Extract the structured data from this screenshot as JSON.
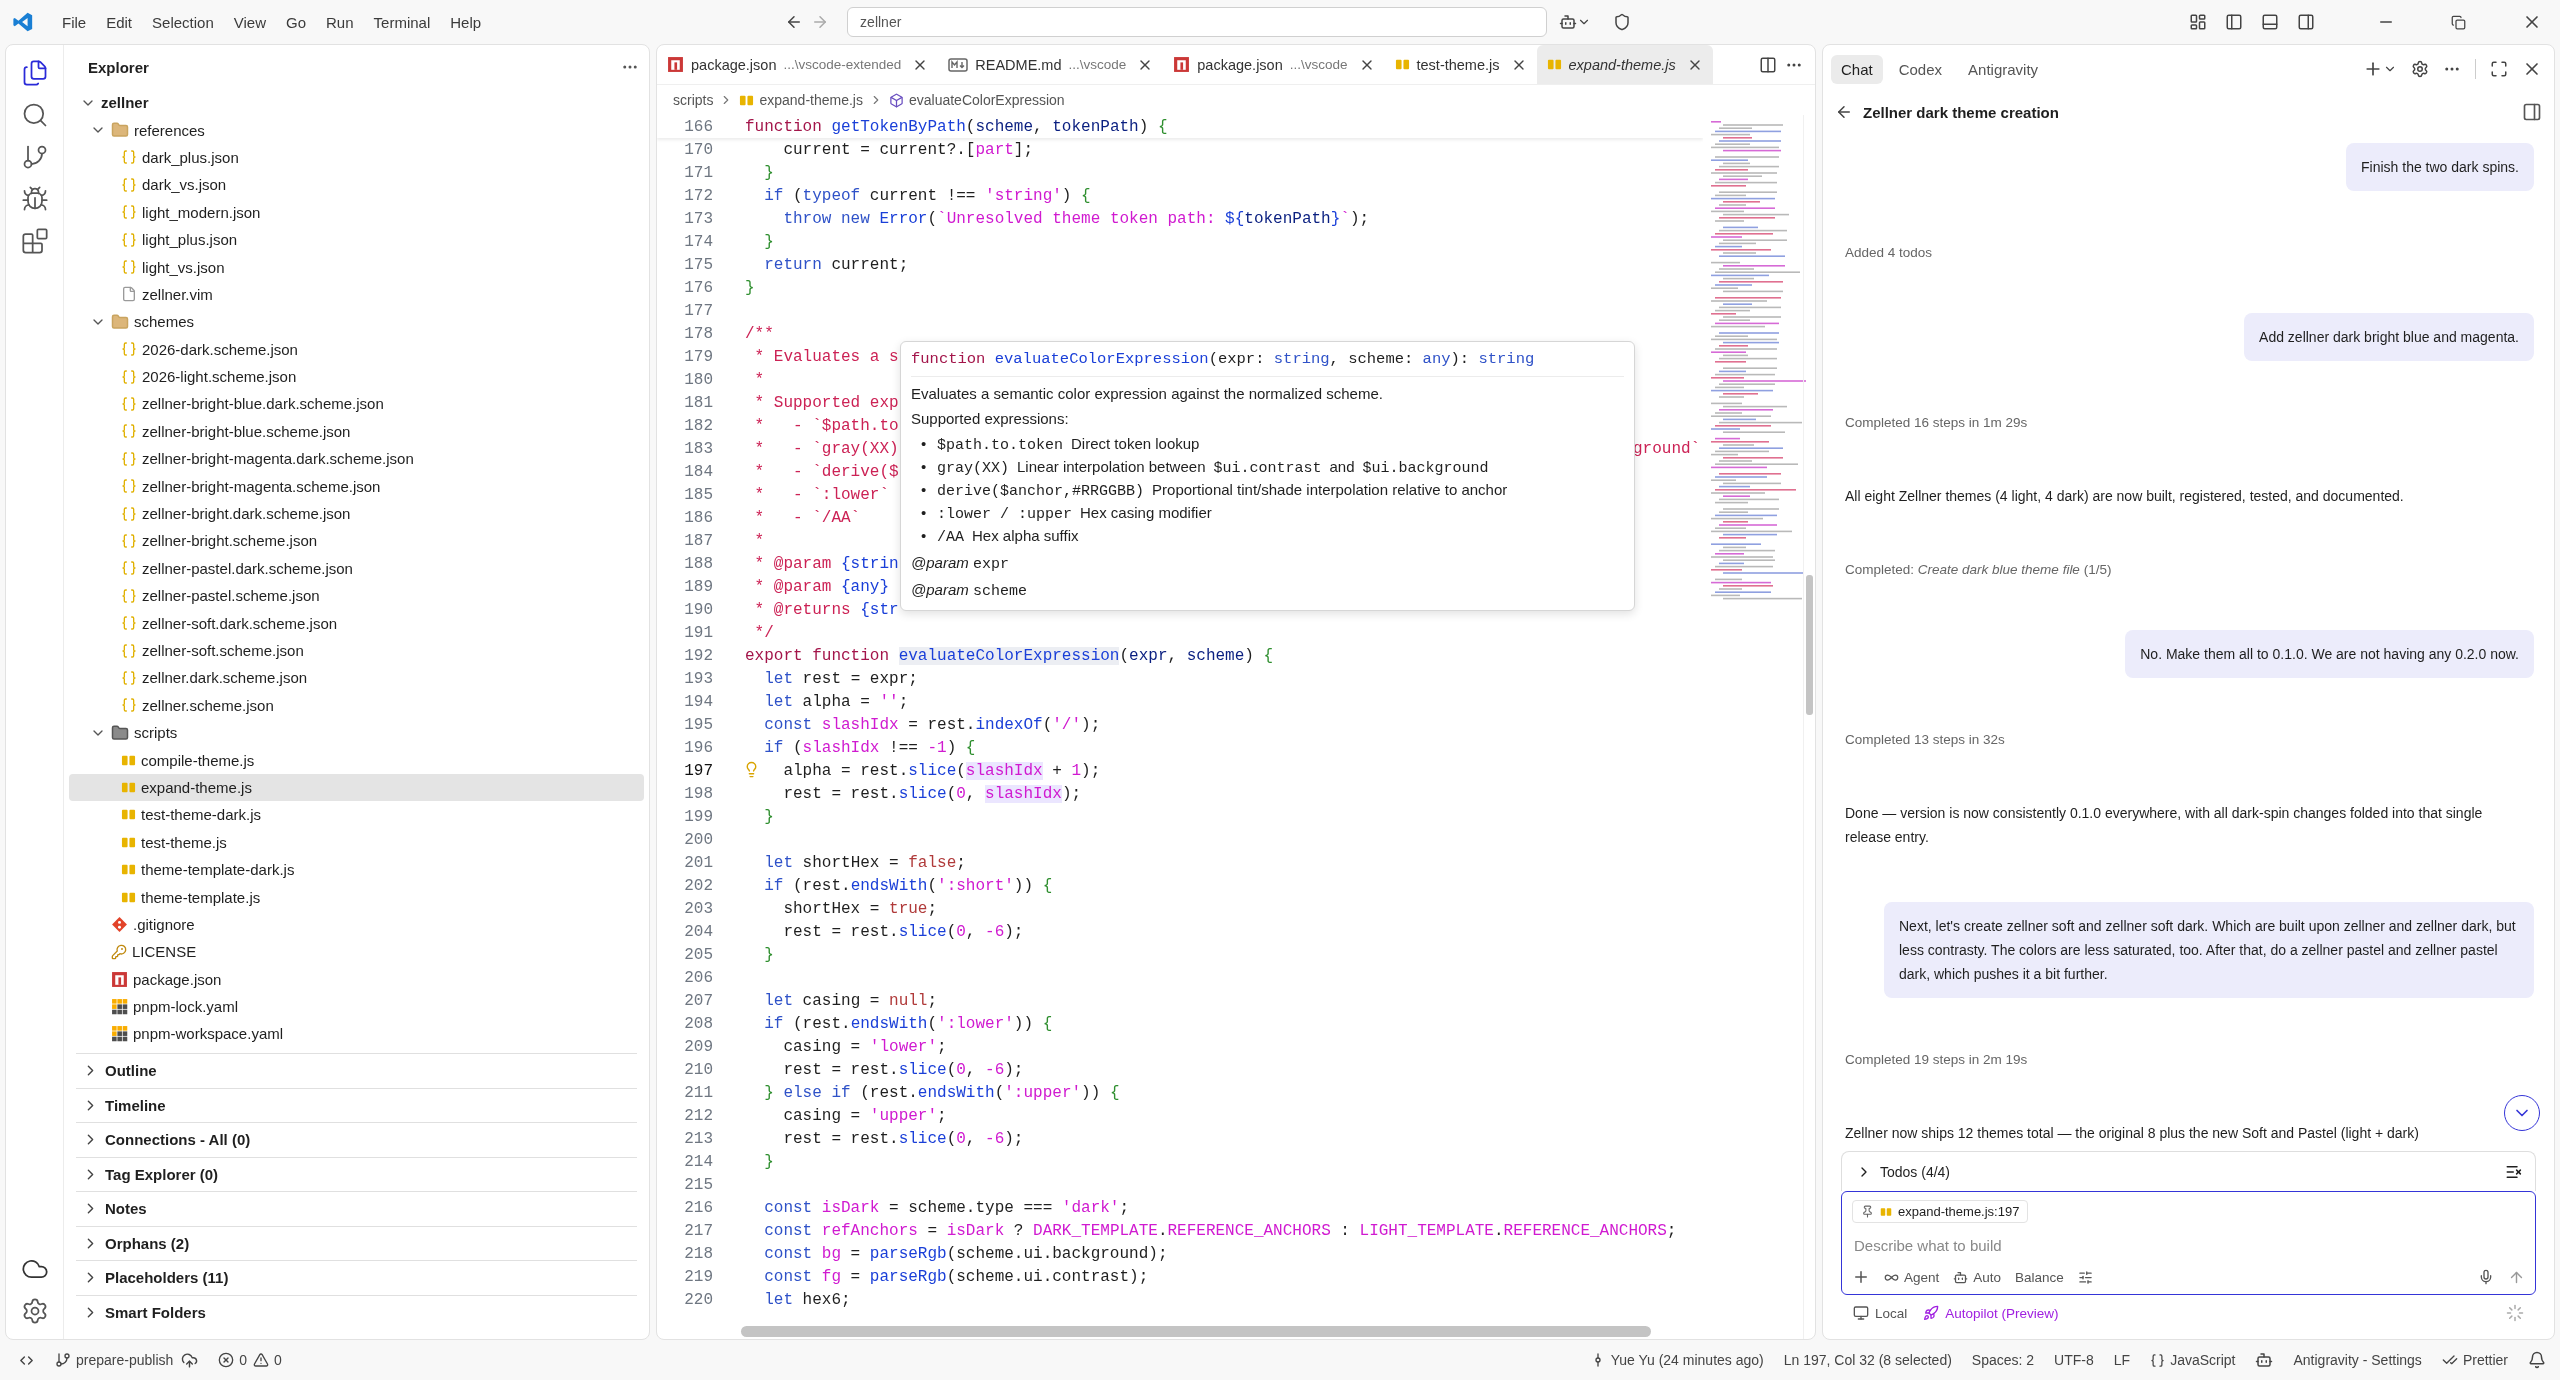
{
  "title_bar": {
    "menu": [
      "File",
      "Edit",
      "Selection",
      "View",
      "Go",
      "Run",
      "Terminal",
      "Help"
    ],
    "search": "zellner"
  },
  "activity_bar": [
    {
      "kind": "files",
      "selected": true
    },
    {
      "kind": "search",
      "selected": false
    },
    {
      "kind": "source-control",
      "selected": false
    },
    {
      "kind": "run",
      "selected": false
    },
    {
      "kind": "extensions",
      "selected": false
    }
  ],
  "explorer": {
    "title": "Explorer",
    "tree": {
      "label": "zellner",
      "kind": "root",
      "expanded": true,
      "selected": false,
      "children": [
        {
          "label": "references",
          "kind": "folder",
          "expanded": true,
          "selected": false,
          "children": [
            {
              "label": "dark_plus.json",
              "kind": "json",
              "selected": false
            },
            {
              "label": "dark_vs.json",
              "kind": "json",
              "selected": false
            },
            {
              "label": "light_modern.json",
              "kind": "json",
              "selected": false
            },
            {
              "label": "light_plus.json",
              "kind": "json",
              "selected": false
            },
            {
              "label": "light_vs.json",
              "kind": "json",
              "selected": false
            },
            {
              "label": "zellner.vim",
              "kind": "file",
              "selected": false
            }
          ]
        },
        {
          "label": "schemes",
          "kind": "folder",
          "expanded": true,
          "selected": false,
          "children": [
            {
              "label": "2026-dark.scheme.json",
              "kind": "json",
              "selected": false
            },
            {
              "label": "2026-light.scheme.json",
              "kind": "json",
              "selected": false
            },
            {
              "label": "zellner-bright-blue.dark.scheme.json",
              "kind": "json",
              "selected": false
            },
            {
              "label": "zellner-bright-blue.scheme.json",
              "kind": "json",
              "selected": false
            },
            {
              "label": "zellner-bright-magenta.dark.scheme.json",
              "kind": "json",
              "selected": false
            },
            {
              "label": "zellner-bright-magenta.scheme.json",
              "kind": "json",
              "selected": false
            },
            {
              "label": "zellner-bright.dark.scheme.json",
              "kind": "json",
              "selected": false
            },
            {
              "label": "zellner-bright.scheme.json",
              "kind": "json",
              "selected": false
            },
            {
              "label": "zellner-pastel.dark.scheme.json",
              "kind": "json",
              "selected": false
            },
            {
              "label": "zellner-pastel.scheme.json",
              "kind": "json",
              "selected": false
            },
            {
              "label": "zellner-soft.dark.scheme.json",
              "kind": "json",
              "selected": false
            },
            {
              "label": "zellner-soft.scheme.json",
              "kind": "json",
              "selected": false
            },
            {
              "label": "zellner.dark.scheme.json",
              "kind": "json",
              "selected": false
            },
            {
              "label": "zellner.scheme.json",
              "kind": "json",
              "selected": false
            }
          ]
        },
        {
          "label": "scripts",
          "kind": "scripts",
          "expanded": true,
          "selected": false,
          "children": [
            {
              "label": "compile-theme.js",
              "kind": "js",
              "selected": false
            },
            {
              "label": "expand-theme.js",
              "kind": "js",
              "selected": true
            },
            {
              "label": "test-theme-dark.js",
              "kind": "js",
              "selected": false
            },
            {
              "label": "test-theme.js",
              "kind": "js",
              "selected": false
            },
            {
              "label": "theme-template-dark.js",
              "kind": "js",
              "selected": false
            },
            {
              "label": "theme-template.js",
              "kind": "js",
              "selected": false
            }
          ]
        },
        {
          "label": ".gitignore",
          "kind": "git",
          "selected": false
        },
        {
          "label": "LICENSE",
          "kind": "license",
          "selected": false
        },
        {
          "label": "package.json",
          "kind": "npm",
          "selected": false
        },
        {
          "label": "pnpm-lock.yaml",
          "kind": "pnpm",
          "selected": false
        },
        {
          "label": "pnpm-workspace.yaml",
          "kind": "pnpm",
          "selected": false
        }
      ]
    },
    "sections": [
      {
        "label": "Outline",
        "expanded": false
      },
      {
        "label": "Timeline",
        "expanded": false
      },
      {
        "label": "Connections - All (0)",
        "expanded": false
      },
      {
        "label": "Tag Explorer (0)",
        "expanded": false
      },
      {
        "label": "Notes",
        "expanded": false
      },
      {
        "label": "Orphans (2)",
        "expanded": false
      },
      {
        "label": "Placeholders (11)",
        "expanded": false
      },
      {
        "label": "Smart Folders",
        "expanded": false
      }
    ]
  },
  "editor": {
    "tabs": [
      {
        "label": "package.json",
        "path": "...\\vscode-extended",
        "kind": "npm",
        "selected": false,
        "preview": false
      },
      {
        "label": "README.md",
        "path": "...\\vscode",
        "kind": "md",
        "selected": false,
        "preview": false
      },
      {
        "label": "package.json",
        "path": "...\\vscode",
        "kind": "npm",
        "selected": false,
        "preview": false
      },
      {
        "label": "test-theme.js",
        "kind": "js",
        "selected": false,
        "preview": false
      },
      {
        "label": "expand-theme.js",
        "kind": "js",
        "selected": true,
        "preview": true
      }
    ],
    "breadcrumbs": [
      {
        "label": "scripts",
        "kind": "dir"
      },
      {
        "label": "expand-theme.js",
        "kind": "js"
      },
      {
        "label": "evaluateColorExpression",
        "kind": "symbol"
      }
    ],
    "sticky": {
      "n": "166",
      "t": [
        {
          "text": "function ",
          "kind": "decl"
        },
        {
          "text": "getTokenByPath",
          "kind": "fn"
        },
        {
          "text": "(",
          "kind": "plain"
        },
        {
          "text": "scheme",
          "kind": "param"
        },
        {
          "text": ", ",
          "kind": "plain"
        },
        {
          "text": "tokenPath",
          "kind": "param"
        },
        {
          "text": ") ",
          "kind": "plain"
        },
        {
          "text": "{",
          "kind": "brace"
        }
      ]
    },
    "lines": [
      {
        "n": "170",
        "t": [
          {
            "text": "    current = current?.[",
            "kind": "plain"
          },
          {
            "text": "part",
            "kind": "str"
          },
          {
            "text": "];",
            "kind": "plain"
          }
        ]
      },
      {
        "n": "171",
        "t": [
          {
            "text": "  }",
            "kind": "brace"
          }
        ]
      },
      {
        "n": "172",
        "t": [
          {
            "text": "  if",
            "kind": "kw"
          },
          {
            "text": " (",
            "kind": "plain"
          },
          {
            "text": "typeof",
            "kind": "kw"
          },
          {
            "text": " current !== ",
            "kind": "plain"
          },
          {
            "text": "'string'",
            "kind": "str"
          },
          {
            "text": ") ",
            "kind": "plain"
          },
          {
            "text": "{",
            "kind": "brace"
          }
        ]
      },
      {
        "n": "173",
        "t": [
          {
            "text": "    throw new ",
            "kind": "kw"
          },
          {
            "text": "Error",
            "kind": "fn"
          },
          {
            "text": "(",
            "kind": "plain"
          },
          {
            "text": "`Unresolved theme token path: ",
            "kind": "str"
          },
          {
            "text": "${",
            "kind": "fn"
          },
          {
            "text": "tokenPath",
            "kind": "param"
          },
          {
            "text": "}",
            "kind": "fn"
          },
          {
            "text": "`",
            "kind": "str"
          },
          {
            "text": ");",
            "kind": "plain"
          }
        ]
      },
      {
        "n": "174",
        "t": [
          {
            "text": "  }",
            "kind": "brace"
          }
        ]
      },
      {
        "n": "175",
        "t": [
          {
            "text": "  return",
            "kind": "kw"
          },
          {
            "text": " current;",
            "kind": "plain"
          }
        ]
      },
      {
        "n": "176",
        "t": [
          {
            "text": "}",
            "kind": "brace"
          }
        ]
      },
      {
        "n": "177"
      },
      {
        "n": "178",
        "t": [
          {
            "text": "/**",
            "kind": "comment"
          }
        ]
      },
      {
        "n": "179",
        "t": [
          {
            "text": " * Evaluates a s",
            "kind": "comment"
          }
        ]
      },
      {
        "n": "180",
        "t": [
          {
            "text": " *",
            "kind": "comment"
          }
        ]
      },
      {
        "n": "181",
        "t": [
          {
            "text": " * Supported exp",
            "kind": "comment"
          }
        ]
      },
      {
        "n": "182",
        "t": [
          {
            "text": " *   - `$path.to",
            "kind": "comment"
          }
        ]
      },
      {
        "n": "183",
        "t": [
          {
            "text": " *   - `gray(XX)",
            "kind": "comment"
          }
        ],
        "tail": "ground`"
      },
      {
        "n": "184",
        "t": [
          {
            "text": " *   - `derive($",
            "kind": "comment"
          }
        ]
      },
      {
        "n": "185",
        "t": [
          {
            "text": " *   - `:lower`",
            "kind": "comment"
          }
        ]
      },
      {
        "n": "186",
        "t": [
          {
            "text": " *   - `/AA`",
            "kind": "comment"
          }
        ]
      },
      {
        "n": "187",
        "t": [
          {
            "text": " *",
            "kind": "comment"
          }
        ]
      },
      {
        "n": "188",
        "t": [
          {
            "text": " * @param ",
            "kind": "comment"
          },
          {
            "text": "{strin",
            "kind": "fn"
          }
        ]
      },
      {
        "n": "189",
        "t": [
          {
            "text": " * @param ",
            "kind": "comment"
          },
          {
            "text": "{any}",
            "kind": "fn"
          }
        ]
      },
      {
        "n": "190",
        "t": [
          {
            "text": " * @returns ",
            "kind": "comment"
          },
          {
            "text": "{str",
            "kind": "fn"
          }
        ]
      },
      {
        "n": "191",
        "t": [
          {
            "text": " */",
            "kind": "comment"
          }
        ]
      },
      {
        "n": "192",
        "t": [
          {
            "text": "export function ",
            "kind": "decl"
          },
          {
            "text": "evaluateColorExpression",
            "kind": "fnhl"
          },
          {
            "text": "(",
            "kind": "plain"
          },
          {
            "text": "expr",
            "kind": "param"
          },
          {
            "text": ", ",
            "kind": "plain"
          },
          {
            "text": "scheme",
            "kind": "param"
          },
          {
            "text": ") ",
            "kind": "plain"
          },
          {
            "text": "{",
            "kind": "brace"
          }
        ]
      },
      {
        "n": "193",
        "t": [
          {
            "text": "  let",
            "kind": "kw"
          },
          {
            "text": " rest = expr;",
            "kind": "plain"
          }
        ]
      },
      {
        "n": "194",
        "t": [
          {
            "text": "  let",
            "kind": "kw"
          },
          {
            "text": " alpha = ",
            "kind": "plain"
          },
          {
            "text": "''",
            "kind": "str"
          },
          {
            "text": ";",
            "kind": "plain"
          }
        ]
      },
      {
        "n": "195",
        "t": [
          {
            "text": "  const ",
            "kind": "kw"
          },
          {
            "text": "slashIdx",
            "kind": "var"
          },
          {
            "text": " = rest.",
            "kind": "plain"
          },
          {
            "text": "indexOf",
            "kind": "fn"
          },
          {
            "text": "(",
            "kind": "plain"
          },
          {
            "text": "'/'",
            "kind": "str"
          },
          {
            "text": ");",
            "kind": "plain"
          }
        ]
      },
      {
        "n": "196",
        "t": [
          {
            "text": "  if",
            "kind": "kw"
          },
          {
            "text": " (",
            "kind": "plain"
          },
          {
            "text": "slashIdx",
            "kind": "var"
          },
          {
            "text": " !== ",
            "kind": "plain"
          },
          {
            "text": "-1",
            "kind": "num"
          },
          {
            "text": ") ",
            "kind": "plain"
          },
          {
            "text": "{",
            "kind": "brace"
          }
        ]
      },
      {
        "n": "197",
        "current": true,
        "lightbulb": true,
        "t": [
          {
            "text": "    alpha = rest.",
            "kind": "plain"
          },
          {
            "text": "slice",
            "kind": "fn"
          },
          {
            "text": "(",
            "kind": "plain"
          },
          {
            "text": "slashIdx",
            "kind": "varhl"
          },
          {
            "text": " + ",
            "kind": "plain"
          },
          {
            "text": "1",
            "kind": "num"
          },
          {
            "text": ");",
            "kind": "plain"
          }
        ]
      },
      {
        "n": "198",
        "t": [
          {
            "text": "    rest = rest.",
            "kind": "plain"
          },
          {
            "text": "slice",
            "kind": "fn"
          },
          {
            "text": "(",
            "kind": "plain"
          },
          {
            "text": "0",
            "kind": "num"
          },
          {
            "text": ", ",
            "kind": "plain"
          },
          {
            "text": "slashIdx",
            "kind": "varhl"
          },
          {
            "text": ");",
            "kind": "plain"
          }
        ]
      },
      {
        "n": "199",
        "t": [
          {
            "text": "  }",
            "kind": "brace"
          }
        ]
      },
      {
        "n": "200"
      },
      {
        "n": "201",
        "t": [
          {
            "text": "  let",
            "kind": "kw"
          },
          {
            "text": " shortHex = ",
            "kind": "plain"
          },
          {
            "text": "false",
            "kind": "lit"
          },
          {
            "text": ";",
            "kind": "plain"
          }
        ]
      },
      {
        "n": "202",
        "t": [
          {
            "text": "  if",
            "kind": "kw"
          },
          {
            "text": " (rest.",
            "kind": "plain"
          },
          {
            "text": "endsWith",
            "kind": "fn"
          },
          {
            "text": "(",
            "kind": "plain"
          },
          {
            "text": "':short'",
            "kind": "str"
          },
          {
            "text": ")) ",
            "kind": "plain"
          },
          {
            "text": "{",
            "kind": "brace"
          }
        ]
      },
      {
        "n": "203",
        "t": [
          {
            "text": "    shortHex = ",
            "kind": "plain"
          },
          {
            "text": "true",
            "kind": "lit"
          },
          {
            "text": ";",
            "kind": "plain"
          }
        ]
      },
      {
        "n": "204",
        "t": [
          {
            "text": "    rest = rest.",
            "kind": "plain"
          },
          {
            "text": "slice",
            "kind": "fn"
          },
          {
            "text": "(",
            "kind": "plain"
          },
          {
            "text": "0",
            "kind": "num"
          },
          {
            "text": ", ",
            "kind": "plain"
          },
          {
            "text": "-6",
            "kind": "num"
          },
          {
            "text": ");",
            "kind": "plain"
          }
        ]
      },
      {
        "n": "205",
        "t": [
          {
            "text": "  }",
            "kind": "brace"
          }
        ]
      },
      {
        "n": "206"
      },
      {
        "n": "207",
        "t": [
          {
            "text": "  let",
            "kind": "kw"
          },
          {
            "text": " casing = ",
            "kind": "plain"
          },
          {
            "text": "null",
            "kind": "lit"
          },
          {
            "text": ";",
            "kind": "plain"
          }
        ]
      },
      {
        "n": "208",
        "t": [
          {
            "text": "  if",
            "kind": "kw"
          },
          {
            "text": " (rest.",
            "kind": "plain"
          },
          {
            "text": "endsWith",
            "kind": "fn"
          },
          {
            "text": "(",
            "kind": "plain"
          },
          {
            "text": "':lower'",
            "kind": "str"
          },
          {
            "text": ")) ",
            "kind": "plain"
          },
          {
            "text": "{",
            "kind": "brace"
          }
        ]
      },
      {
        "n": "209",
        "t": [
          {
            "text": "    casing = ",
            "kind": "plain"
          },
          {
            "text": "'lower'",
            "kind": "str"
          },
          {
            "text": ";",
            "kind": "plain"
          }
        ]
      },
      {
        "n": "210",
        "t": [
          {
            "text": "    rest = rest.",
            "kind": "plain"
          },
          {
            "text": "slice",
            "kind": "fn"
          },
          {
            "text": "(",
            "kind": "plain"
          },
          {
            "text": "0",
            "kind": "num"
          },
          {
            "text": ", ",
            "kind": "plain"
          },
          {
            "text": "-6",
            "kind": "num"
          },
          {
            "text": ");",
            "kind": "plain"
          }
        ]
      },
      {
        "n": "211",
        "t": [
          {
            "text": "  }",
            "kind": "brace"
          },
          {
            "text": " else if",
            "kind": "kw"
          },
          {
            "text": " (rest.",
            "kind": "plain"
          },
          {
            "text": "endsWith",
            "kind": "fn"
          },
          {
            "text": "(",
            "kind": "plain"
          },
          {
            "text": "':upper'",
            "kind": "str"
          },
          {
            "text": ")) ",
            "kind": "plain"
          },
          {
            "text": "{",
            "kind": "brace"
          }
        ]
      },
      {
        "n": "212",
        "t": [
          {
            "text": "    casing = ",
            "kind": "plain"
          },
          {
            "text": "'upper'",
            "kind": "str"
          },
          {
            "text": ";",
            "kind": "plain"
          }
        ]
      },
      {
        "n": "213",
        "t": [
          {
            "text": "    rest = rest.",
            "kind": "plain"
          },
          {
            "text": "slice",
            "kind": "fn"
          },
          {
            "text": "(",
            "kind": "plain"
          },
          {
            "text": "0",
            "kind": "num"
          },
          {
            "text": ", ",
            "kind": "plain"
          },
          {
            "text": "-6",
            "kind": "num"
          },
          {
            "text": ");",
            "kind": "plain"
          }
        ]
      },
      {
        "n": "214",
        "t": [
          {
            "text": "  }",
            "kind": "brace"
          }
        ]
      },
      {
        "n": "215"
      },
      {
        "n": "216",
        "t": [
          {
            "text": "  const ",
            "kind": "kw"
          },
          {
            "text": "isDark",
            "kind": "var"
          },
          {
            "text": " = scheme.type === ",
            "kind": "plain"
          },
          {
            "text": "'dark'",
            "kind": "str"
          },
          {
            "text": ";",
            "kind": "plain"
          }
        ]
      },
      {
        "n": "217",
        "t": [
          {
            "text": "  const ",
            "kind": "kw"
          },
          {
            "text": "refAnchors",
            "kind": "var"
          },
          {
            "text": " = ",
            "kind": "plain"
          },
          {
            "text": "isDark",
            "kind": "var"
          },
          {
            "text": " ? ",
            "kind": "plain"
          },
          {
            "text": "DARK_TEMPLATE",
            "kind": "var"
          },
          {
            "text": ".",
            "kind": "plain"
          },
          {
            "text": "REFERENCE_ANCHORS",
            "kind": "var"
          },
          {
            "text": " : ",
            "kind": "plain"
          },
          {
            "text": "LIGHT_TEMPLATE",
            "kind": "var"
          },
          {
            "text": ".",
            "kind": "plain"
          },
          {
            "text": "REFERENCE_ANCHORS",
            "kind": "var"
          },
          {
            "text": ";",
            "kind": "plain"
          }
        ]
      },
      {
        "n": "218",
        "t": [
          {
            "text": "  const ",
            "kind": "kw"
          },
          {
            "text": "bg",
            "kind": "var"
          },
          {
            "text": " = ",
            "kind": "plain"
          },
          {
            "text": "parseRgb",
            "kind": "fn"
          },
          {
            "text": "(scheme.ui.background);",
            "kind": "plain"
          }
        ]
      },
      {
        "n": "219",
        "t": [
          {
            "text": "  const ",
            "kind": "kw"
          },
          {
            "text": "fg",
            "kind": "var"
          },
          {
            "text": " = ",
            "kind": "plain"
          },
          {
            "text": "parseRgb",
            "kind": "fn"
          },
          {
            "text": "(scheme.ui.contrast);",
            "kind": "plain"
          }
        ]
      },
      {
        "n": "220",
        "t": [
          {
            "text": "  let",
            "kind": "kw"
          },
          {
            "text": " hex6;",
            "kind": "plain"
          }
        ]
      }
    ],
    "hover": {
      "signature": [
        {
          "text": "function ",
          "kind": "decl"
        },
        {
          "text": "evaluateColorExpression",
          "kind": "fn"
        },
        {
          "text": "(expr: ",
          "kind": "plain"
        },
        {
          "text": "string",
          "kind": "kw"
        },
        {
          "text": ", scheme: ",
          "kind": "plain"
        },
        {
          "text": "any",
          "kind": "kw"
        },
        {
          "text": "): ",
          "kind": "plain"
        },
        {
          "text": "string",
          "kind": "kw"
        }
      ],
      "description": "Evaluates a semantic color expression against the normalized scheme.",
      "list_title": "Supported expressions:",
      "items": [
        {
          "bullet": "•",
          "parts": [
            {
              "text": "$path.to.token",
              "kind": "code"
            },
            {
              "text": "Direct token lookup",
              "kind": "prose"
            }
          ]
        },
        {
          "bullet": "•",
          "parts": [
            {
              "text": "gray(XX)",
              "kind": "code"
            },
            {
              "text": "Linear interpolation between",
              "kind": "prose"
            },
            {
              "text": "$ui.contrast",
              "kind": "code"
            },
            {
              "text": "and",
              "kind": "prose"
            },
            {
              "text": "$ui.background",
              "kind": "code"
            }
          ]
        },
        {
          "bullet": "•",
          "parts": [
            {
              "text": "derive($anchor,#RRGGBB)",
              "kind": "code"
            },
            {
              "text": "Proportional tint/shade interpolation relative to anchor",
              "kind": "prose"
            }
          ]
        },
        {
          "bullet": "•",
          "parts": [
            {
              "text": ":lower / :upper",
              "kind": "code"
            },
            {
              "text": "Hex casing modifier",
              "kind": "prose"
            }
          ]
        },
        {
          "bullet": "•",
          "parts": [
            {
              "text": "/AA",
              "kind": "code"
            },
            {
              "text": "Hex alpha suffix",
              "kind": "prose"
            }
          ]
        }
      ],
      "params": [
        {
          "tag": "@param",
          "name": "expr"
        },
        {
          "tag": "@param",
          "name": "scheme"
        }
      ]
    }
  },
  "chat": {
    "tabs": [
      {
        "label": "Chat",
        "selected": true
      },
      {
        "label": "Codex",
        "selected": false
      },
      {
        "label": "Antigravity",
        "selected": false
      }
    ],
    "title": "Zellner dark theme creation",
    "messages": [
      {
        "kind": "user",
        "text": "Finish the two dark spins."
      },
      {
        "kind": "status",
        "text": "Added 4 todos"
      },
      {
        "kind": "user",
        "text": "Add zellner dark bright blue and magenta."
      },
      {
        "kind": "status",
        "text": "Completed 16 steps in 1m 29s"
      },
      {
        "kind": "reply",
        "text": "All eight Zellner themes (4 light, 4 dark) are now built, registered, tested, and documented."
      },
      {
        "kind": "status",
        "text": "Completed: *Create dark blue theme file* (1/5)"
      },
      {
        "kind": "user",
        "text": "No. Make them all to 0.1.0. We are not having any 0.2.0 now."
      },
      {
        "kind": "status",
        "text": "Completed 13 steps in 32s"
      },
      {
        "kind": "reply",
        "text": "Done — version is now consistently 0.1.0 everywhere, with all dark-spin changes folded into that single release entry."
      },
      {
        "kind": "user",
        "text": "Next, let's create zellner soft and zellner soft dark. Which are built upon zellner and zellner dark, but less contrasty. The colors are less saturated, too. After that, do a zellner pastel and zellner pastel dark, which pushes it a bit further."
      },
      {
        "kind": "status",
        "text": "Completed 19 steps in 2m 19s"
      },
      {
        "kind": "reply",
        "text": "Zellner now ships 12 themes total — the original 8 plus the new Soft and Pastel (light + dark)"
      }
    ],
    "todos": {
      "label": "Todos (4/4)",
      "expanded": false
    },
    "input": {
      "attachment": "expand-theme.js:197",
      "placeholder": "Describe what to build",
      "mode": "Agent",
      "model": "Auto",
      "effort": "Balance"
    },
    "footer": {
      "location": "Local",
      "autopilot": "Autopilot (Preview)"
    }
  },
  "status_bar": {
    "branch": "prepare-publish",
    "errors": "0",
    "warnings": "0",
    "blame": "Yue Yu (24 minutes ago)",
    "position": "Ln 197, Col 32 (8 selected)",
    "indent": "Spaces: 2",
    "encoding": "UTF-8",
    "eol": "LF",
    "language": "JavaScript",
    "agent": "Antigravity - Settings",
    "formatter": "Prettier"
  }
}
